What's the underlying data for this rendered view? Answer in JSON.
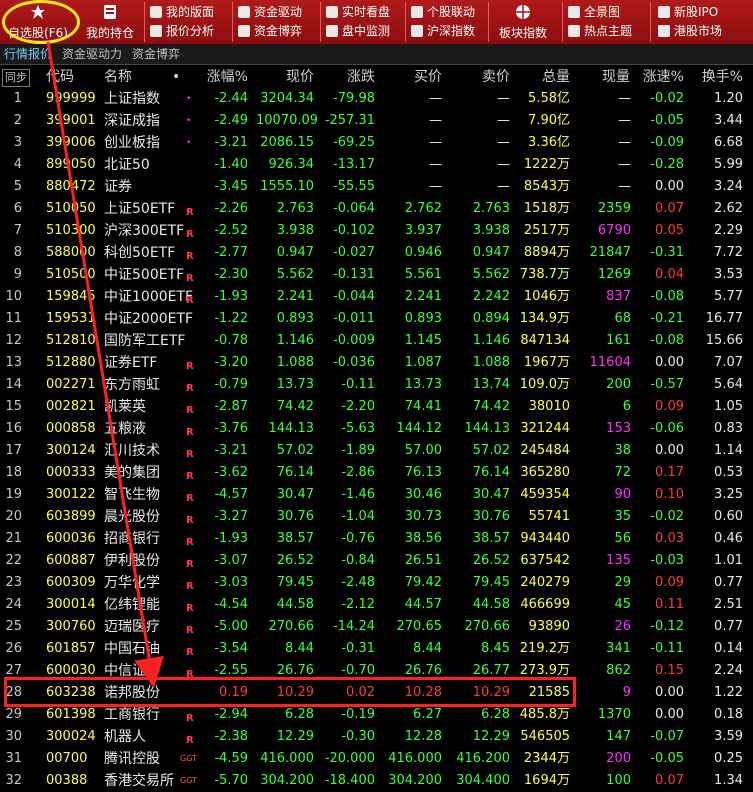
{
  "toolbar": {
    "big": [
      {
        "label": "自选股(F6)",
        "icon": "star-icon"
      },
      {
        "label": "我的持仓",
        "icon": "portfolio-icon"
      },
      {
        "label": "板块指数",
        "icon": "globe-icon"
      }
    ],
    "small": [
      {
        "label": "我的版面",
        "icon": "layout-icon"
      },
      {
        "label": "报价分析",
        "icon": "quote-icon"
      },
      {
        "label": "资金驱动",
        "icon": "capital-icon"
      },
      {
        "label": "资金博弈",
        "icon": "game-icon"
      },
      {
        "label": "实时看盘",
        "icon": "chart-icon"
      },
      {
        "label": "盘中监测",
        "icon": "monitor-icon"
      },
      {
        "label": "个股联动",
        "icon": "link-icon"
      },
      {
        "label": "沪深指数",
        "icon": "index-icon"
      },
      {
        "label": "全景图",
        "icon": "panorama-icon"
      },
      {
        "label": "热点主题",
        "icon": "fire-icon"
      },
      {
        "label": "新股IPO",
        "icon": "ipo-icon"
      },
      {
        "label": "港股市场",
        "icon": "hk-icon"
      }
    ]
  },
  "tabs": [
    "行情报价",
    "资金驱动力",
    "资金博弈"
  ],
  "sync_label": "同步",
  "columns": [
    "代码",
    "名称",
    "•",
    "涨幅%",
    "现价",
    "涨跌",
    "买价",
    "卖价",
    "总量",
    "现量",
    "涨速%",
    "换手%"
  ],
  "rows": [
    [
      "1",
      "999999",
      "上证指数",
      "•",
      "-2.44",
      "3204.34",
      "-79.98",
      "—",
      "—",
      "5.58亿",
      "—",
      "-0.02",
      "1.20"
    ],
    [
      "2",
      "399001",
      "深证成指",
      "•",
      "-2.49",
      "10070.09",
      "-257.31",
      "—",
      "—",
      "7.90亿",
      "—",
      "-0.05",
      "3.44"
    ],
    [
      "3",
      "399006",
      "创业板指",
      "•",
      "-3.21",
      "2086.15",
      "-69.25",
      "—",
      "—",
      "3.36亿",
      "—",
      "-0.09",
      "6.68"
    ],
    [
      "4",
      "899050",
      "北证50",
      "",
      "-1.40",
      "926.34",
      "-13.17",
      "—",
      "—",
      "1222万",
      "—",
      "-0.28",
      "5.99"
    ],
    [
      "5",
      "880472",
      "证券",
      "",
      "-3.45",
      "1555.10",
      "-55.55",
      "—",
      "—",
      "8543万",
      "—",
      "0.00",
      "3.24"
    ],
    [
      "6",
      "510050",
      "上证50ETF",
      "R",
      "-2.26",
      "2.763",
      "-0.064",
      "2.762",
      "2.763",
      "1518万",
      "2359",
      "0.07",
      "2.62"
    ],
    [
      "7",
      "510300",
      "沪深300ETF",
      "R",
      "-2.52",
      "3.938",
      "-0.102",
      "3.937",
      "3.938",
      "2517万",
      "6790",
      "0.05",
      "2.29"
    ],
    [
      "8",
      "588000",
      "科创50ETF",
      "R",
      "-2.77",
      "0.947",
      "-0.027",
      "0.946",
      "0.947",
      "8894万",
      "21847",
      "-0.31",
      "7.72"
    ],
    [
      "9",
      "510500",
      "中证500ETF",
      "R",
      "-2.30",
      "5.562",
      "-0.131",
      "5.561",
      "5.562",
      "738.7万",
      "1269",
      "0.04",
      "3.53"
    ],
    [
      "10",
      "159845",
      "中证1000ETF",
      "R",
      "-1.93",
      "2.241",
      "-0.044",
      "2.241",
      "2.242",
      "1046万",
      "837",
      "-0.08",
      "5.77"
    ],
    [
      "11",
      "159531",
      "中证2000ETF",
      "",
      "-1.22",
      "0.893",
      "-0.011",
      "0.893",
      "0.894",
      "134.9万",
      "68",
      "-0.21",
      "16.77"
    ],
    [
      "12",
      "512810",
      "国防军工ETF",
      "",
      "-0.78",
      "1.146",
      "-0.009",
      "1.145",
      "1.146",
      "847134",
      "161",
      "-0.08",
      "15.66"
    ],
    [
      "13",
      "512880",
      "证券ETF",
      "R",
      "-3.20",
      "1.088",
      "-0.036",
      "1.087",
      "1.088",
      "1967万",
      "11604",
      "0.00",
      "7.07"
    ],
    [
      "14",
      "002271",
      "东方雨虹",
      "R",
      "-0.79",
      "13.73",
      "-0.11",
      "13.73",
      "13.74",
      "109.0万",
      "200",
      "-0.57",
      "5.64"
    ],
    [
      "15",
      "002821",
      "凯莱英",
      "R",
      "-2.87",
      "74.42",
      "-2.20",
      "74.41",
      "74.42",
      "38010",
      "6",
      "0.09",
      "1.05"
    ],
    [
      "16",
      "000858",
      "五粮液",
      "R",
      "-3.76",
      "144.13",
      "-5.63",
      "144.12",
      "144.13",
      "321244",
      "153",
      "-0.06",
      "0.83"
    ],
    [
      "17",
      "300124",
      "汇川技术",
      "R",
      "-3.21",
      "57.02",
      "-1.89",
      "57.00",
      "57.02",
      "245484",
      "38",
      "0.00",
      "1.14"
    ],
    [
      "18",
      "000333",
      "美的集团",
      "R",
      "-3.62",
      "76.14",
      "-2.86",
      "76.13",
      "76.14",
      "365280",
      "72",
      "0.17",
      "0.53"
    ],
    [
      "19",
      "300122",
      "智飞生物",
      "R",
      "-4.57",
      "30.47",
      "-1.46",
      "30.46",
      "30.47",
      "459354",
      "90",
      "0.10",
      "3.25"
    ],
    [
      "20",
      "603899",
      "晨光股份",
      "R",
      "-3.27",
      "30.76",
      "-1.04",
      "30.73",
      "30.76",
      "55741",
      "35",
      "-0.02",
      "0.60"
    ],
    [
      "21",
      "600036",
      "招商银行",
      "R",
      "-1.93",
      "38.57",
      "-0.76",
      "38.56",
      "38.57",
      "943440",
      "56",
      "0.03",
      "0.46"
    ],
    [
      "22",
      "600887",
      "伊利股份",
      "R",
      "-3.07",
      "26.52",
      "-0.84",
      "26.51",
      "26.52",
      "637542",
      "135",
      "-0.03",
      "1.01"
    ],
    [
      "23",
      "600309",
      "万华化学",
      "R",
      "-3.03",
      "79.45",
      "-2.48",
      "79.42",
      "79.45",
      "240279",
      "29",
      "0.09",
      "0.77"
    ],
    [
      "24",
      "300014",
      "亿纬锂能",
      "R",
      "-4.54",
      "44.58",
      "-2.12",
      "44.57",
      "44.58",
      "466699",
      "45",
      "0.11",
      "2.51"
    ],
    [
      "25",
      "300760",
      "迈瑞医疗",
      "R",
      "-5.00",
      "270.66",
      "-14.24",
      "270.65",
      "270.66",
      "93890",
      "26",
      "-0.12",
      "0.77"
    ],
    [
      "26",
      "601857",
      "中国石油",
      "R",
      "-3.54",
      "8.44",
      "-0.31",
      "8.44",
      "8.45",
      "219.2万",
      "341",
      "-0.11",
      "0.14"
    ],
    [
      "27",
      "600030",
      "中信证券",
      "R",
      "-2.55",
      "26.76",
      "-0.70",
      "26.76",
      "26.77",
      "273.9万",
      "862",
      "0.15",
      "2.24"
    ],
    [
      "28",
      "603238",
      "诺邦股份",
      "",
      "0.19",
      "10.29",
      "0.02",
      "10.28",
      "10.29",
      "21585",
      "9",
      "0.00",
      "1.22"
    ],
    [
      "29",
      "601398",
      "工商银行",
      "R",
      "-2.94",
      "6.28",
      "-0.19",
      "6.27",
      "6.28",
      "485.8万",
      "1370",
      "0.00",
      "0.18"
    ],
    [
      "30",
      "300024",
      "机器人",
      "R",
      "-2.38",
      "12.29",
      "-0.30",
      "12.28",
      "12.29",
      "546505",
      "147",
      "-0.07",
      "3.59"
    ],
    [
      "31",
      "00700",
      "腾讯控股",
      "GGT",
      "-4.59",
      "416.000",
      "-20.000",
      "416.000",
      "416.200",
      "2344万",
      "200",
      "-0.05",
      "0.25"
    ],
    [
      "32",
      "00388",
      "香港交易所",
      "GGT",
      "-5.70",
      "304.200",
      "-18.400",
      "304.200",
      "304.400",
      "1694万",
      "100",
      "0.07",
      "1.34"
    ]
  ],
  "colors": {
    "toolbar": "#a01414",
    "up": "#ff3a3a",
    "down": "#3cff3c",
    "code": "#ffff40",
    "highlight_box": "#ff2020",
    "circle": "#ffe81a"
  }
}
